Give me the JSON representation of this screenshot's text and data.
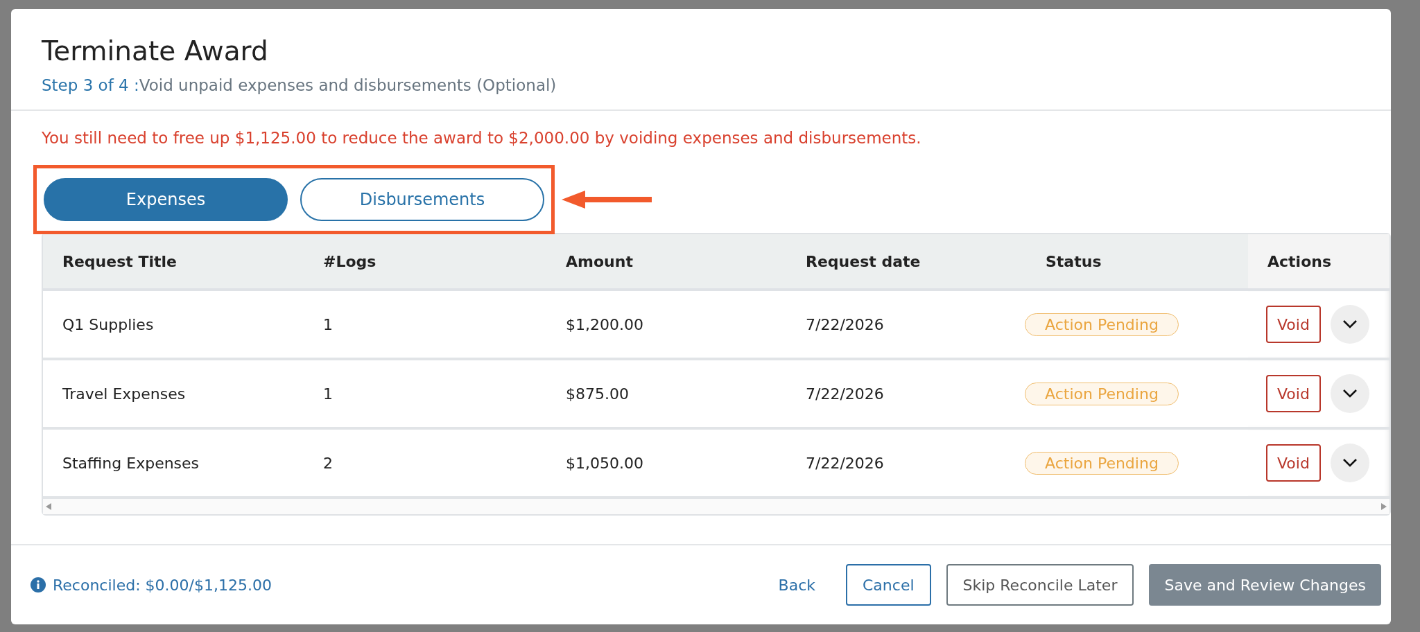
{
  "dialog": {
    "title": "Terminate Award",
    "step": "Step 3 of 4 :",
    "step_description": "Void unpaid expenses and disbursements (Optional)"
  },
  "warning": "You still need to free up $1,125.00 to reduce the award to $2,000.00 by voiding expenses and disbursements.",
  "tabs": [
    {
      "label": "Expenses",
      "selected": true
    },
    {
      "label": "Disbursements",
      "selected": false
    }
  ],
  "table": {
    "columns": [
      "Request Title",
      "#Logs",
      "Amount",
      "Request date",
      "Status",
      "Actions"
    ],
    "rows": [
      {
        "title": "Q1 Supplies",
        "logs": "1",
        "amount": "$1,200.00",
        "date": "7/22/2026",
        "status": "Action Pending",
        "action": "Void"
      },
      {
        "title": "Travel Expenses",
        "logs": "1",
        "amount": "$875.00",
        "date": "7/22/2026",
        "status": "Action Pending",
        "action": "Void"
      },
      {
        "title": "Staffing Expenses",
        "logs": "2",
        "amount": "$1,050.00",
        "date": "7/22/2026",
        "status": "Action Pending",
        "action": "Void"
      }
    ]
  },
  "footer": {
    "reconciled": "Reconciled: $0.00/$1,125.00",
    "buttons": [
      {
        "label": "Back",
        "kind": "link"
      },
      {
        "label": "Cancel",
        "kind": "outline"
      },
      {
        "label": "Skip Reconcile Later",
        "kind": "secondary"
      },
      {
        "label": "Save and Review Changes",
        "kind": "primary"
      }
    ]
  }
}
